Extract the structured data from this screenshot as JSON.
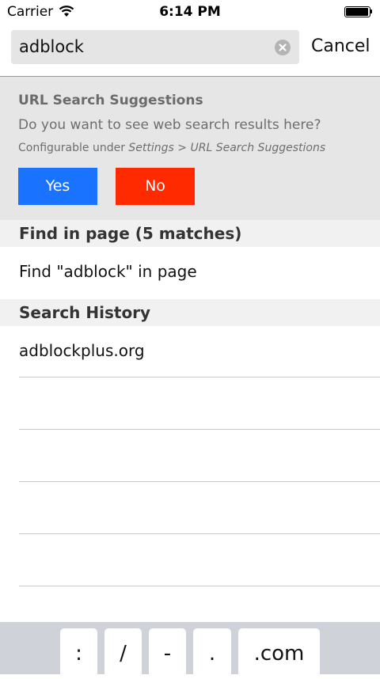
{
  "status_bar": {
    "carrier": "Carrier",
    "time": "6:14 PM"
  },
  "search": {
    "value": "adblock",
    "cancel_label": "Cancel"
  },
  "suggestions": {
    "title": "URL Search Suggestions",
    "question": "Do you want to see web search results here?",
    "config_prefix": "Configurable under ",
    "config_path": "Settings > URL Search Suggestions",
    "yes_label": "Yes",
    "no_label": "No",
    "colors": {
      "yes": "#1a73ff",
      "no": "#ff2a00"
    }
  },
  "find_in_page": {
    "header": "Find in page (5 matches)",
    "row": "Find \"adblock\" in page"
  },
  "search_history": {
    "header": "Search History",
    "items": [
      "adblockplus.org"
    ]
  },
  "keyboard_accessory": {
    "keys": [
      ":",
      "/",
      "-",
      ".",
      ".com"
    ]
  },
  "icons": [
    "wifi-icon",
    "battery-icon",
    "clear-text-icon"
  ]
}
